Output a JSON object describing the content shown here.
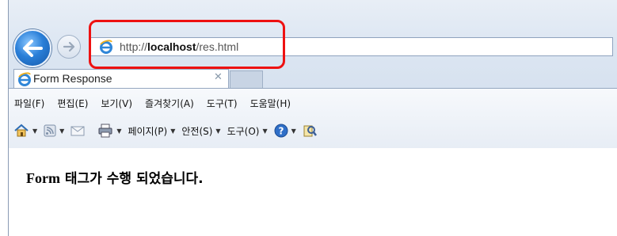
{
  "address": {
    "prefix": "http://",
    "host": "localhost",
    "path": "/res.html"
  },
  "tab": {
    "title": "Form Response",
    "close": "✕"
  },
  "menu": {
    "items": [
      "파일(F)",
      "편집(E)",
      "보기(V)",
      "즐겨찾기(A)",
      "도구(T)",
      "도움말(H)"
    ]
  },
  "commandbar": {
    "page": "페이지(P)",
    "safety": "안전(S)",
    "tools": "도구(O)"
  },
  "content": {
    "message_prefix": "Form",
    "message_rest": " 태그가 수행 되었습니다."
  },
  "colors": {
    "highlight": "#ee1111",
    "back_button": "#2a7fd8"
  }
}
